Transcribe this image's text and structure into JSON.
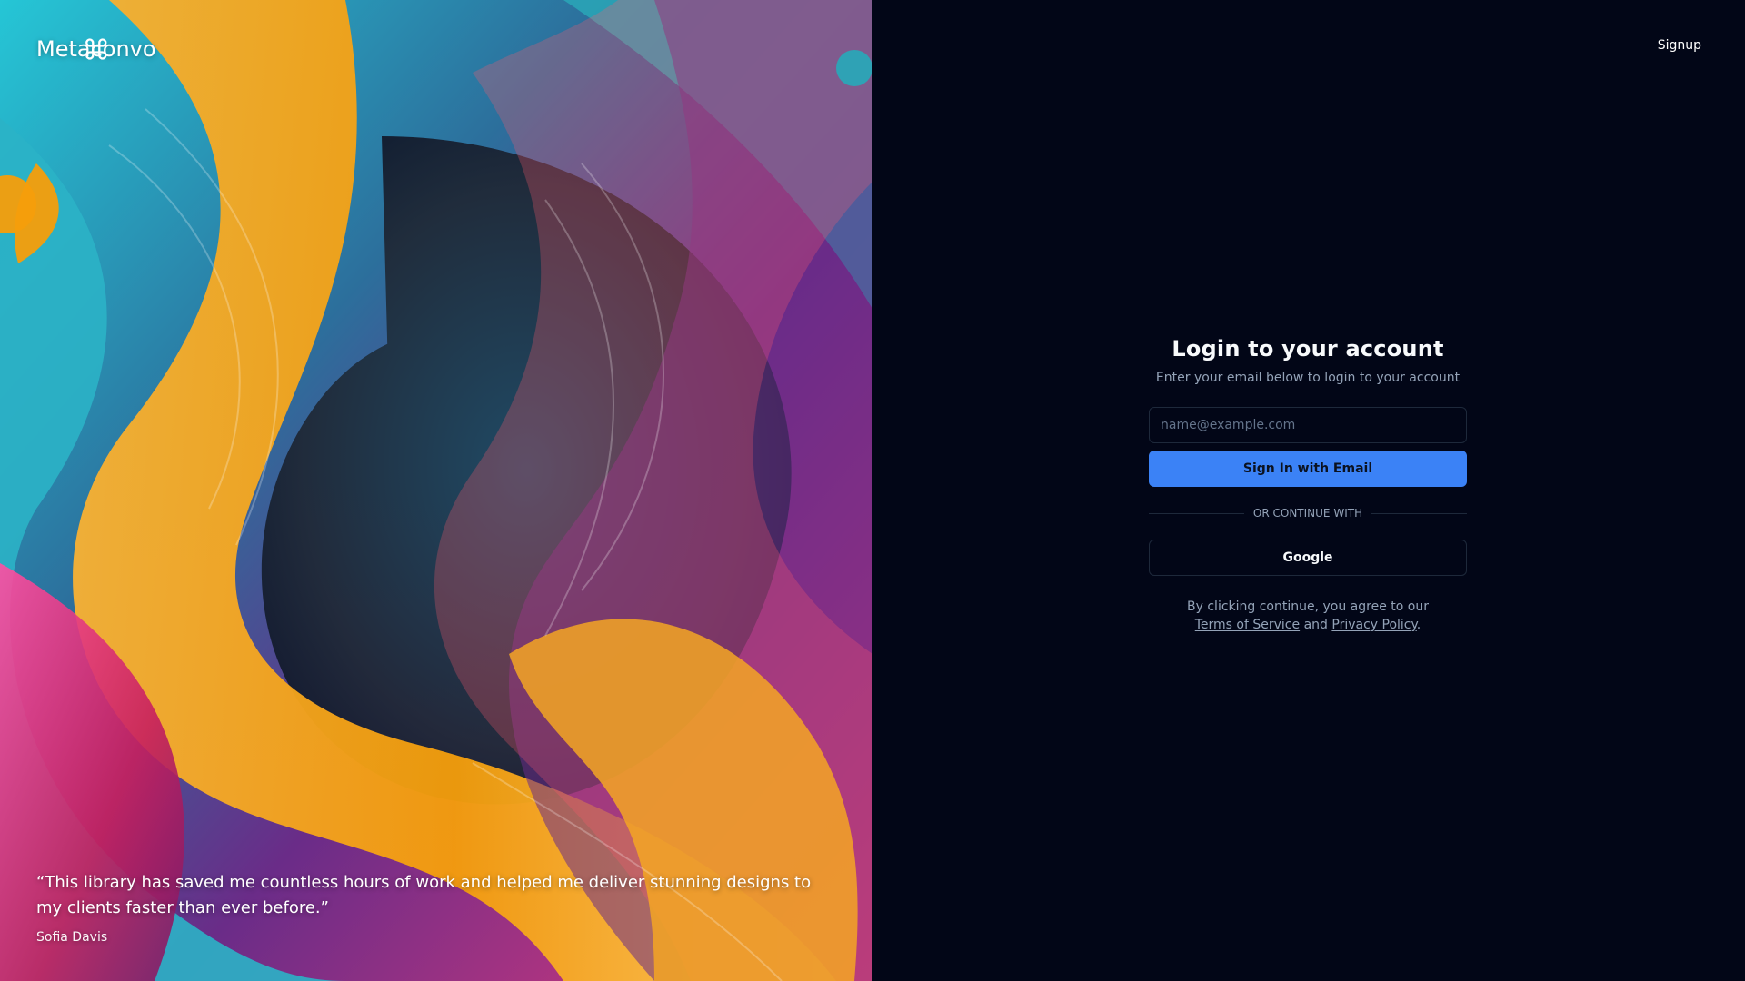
{
  "brand": {
    "name": "Metaconvo",
    "icon": "command-icon"
  },
  "testimonial": {
    "quote": "“This library has saved me countless hours of work and helped me deliver stunning designs to my clients faster than ever before.”",
    "author": "Sofia Davis"
  },
  "header": {
    "signup_label": "Signup"
  },
  "login": {
    "title": "Login to your account",
    "subtitle": "Enter your email below to login to your account",
    "email_placeholder": "name@example.com",
    "email_value": "",
    "sign_in_label": "Sign In with Email",
    "divider_label": "OR CONTINUE WITH",
    "google_label": "Google",
    "legal_prefix": "By clicking continue, you agree to our ",
    "terms_label": "Terms of Service",
    "legal_middle": " and ",
    "privacy_label": "Privacy Policy",
    "legal_suffix": "."
  },
  "colors": {
    "background": "#020617",
    "primary": "#3b82f6",
    "muted_text": "#94a3b8",
    "border": "#1e293b"
  }
}
